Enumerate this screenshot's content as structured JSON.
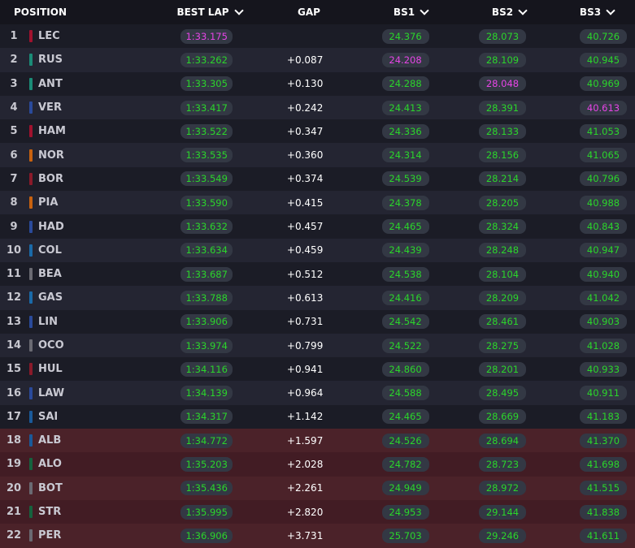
{
  "headers": {
    "position": "POSITION",
    "best_lap": "BEST LAP",
    "gap": "GAP",
    "bs1": "BS1",
    "bs2": "BS2",
    "bs3": "BS3"
  },
  "colors": {
    "personal_best": "#2bd52b",
    "overall_best": "#e645e6",
    "eliminated_row": "#4b2229"
  },
  "rows": [
    {
      "pos": "1",
      "code": "LEC",
      "team_color": "#a0122e",
      "best": "1:33.175",
      "best_purple": true,
      "gap": "",
      "bs1": "24.376",
      "bs1_purple": false,
      "bs2": "28.073",
      "bs2_purple": false,
      "bs3": "40.726",
      "bs3_purple": false,
      "eliminated": false
    },
    {
      "pos": "2",
      "code": "RUS",
      "team_color": "#1b8c77",
      "best": "1:33.262",
      "best_purple": false,
      "gap": "+0.087",
      "bs1": "24.208",
      "bs1_purple": true,
      "bs2": "28.109",
      "bs2_purple": false,
      "bs3": "40.945",
      "bs3_purple": false,
      "eliminated": false
    },
    {
      "pos": "3",
      "code": "ANT",
      "team_color": "#1b8c77",
      "best": "1:33.305",
      "best_purple": false,
      "gap": "+0.130",
      "bs1": "24.288",
      "bs1_purple": false,
      "bs2": "28.048",
      "bs2_purple": true,
      "bs3": "40.969",
      "bs3_purple": false,
      "eliminated": false
    },
    {
      "pos": "4",
      "code": "VER",
      "team_color": "#2a4a9a",
      "best": "1:33.417",
      "best_purple": false,
      "gap": "+0.242",
      "bs1": "24.413",
      "bs1_purple": false,
      "bs2": "28.391",
      "bs2_purple": false,
      "bs3": "40.613",
      "bs3_purple": true,
      "eliminated": false
    },
    {
      "pos": "5",
      "code": "HAM",
      "team_color": "#a0122e",
      "best": "1:33.522",
      "best_purple": false,
      "gap": "+0.347",
      "bs1": "24.336",
      "bs1_purple": false,
      "bs2": "28.133",
      "bs2_purple": false,
      "bs3": "41.053",
      "bs3_purple": false,
      "eliminated": false
    },
    {
      "pos": "6",
      "code": "NOR",
      "team_color": "#c8620f",
      "best": "1:33.535",
      "best_purple": false,
      "gap": "+0.360",
      "bs1": "24.314",
      "bs1_purple": false,
      "bs2": "28.156",
      "bs2_purple": false,
      "bs3": "41.065",
      "bs3_purple": false,
      "eliminated": false
    },
    {
      "pos": "7",
      "code": "BOR",
      "team_color": "#8a1a2a",
      "best": "1:33.549",
      "best_purple": false,
      "gap": "+0.374",
      "bs1": "24.539",
      "bs1_purple": false,
      "bs2": "28.214",
      "bs2_purple": false,
      "bs3": "40.796",
      "bs3_purple": false,
      "eliminated": false
    },
    {
      "pos": "8",
      "code": "PIA",
      "team_color": "#c8620f",
      "best": "1:33.590",
      "best_purple": false,
      "gap": "+0.415",
      "bs1": "24.378",
      "bs1_purple": false,
      "bs2": "28.205",
      "bs2_purple": false,
      "bs3": "40.988",
      "bs3_purple": false,
      "eliminated": false
    },
    {
      "pos": "9",
      "code": "HAD",
      "team_color": "#2a4a9a",
      "best": "1:33.632",
      "best_purple": false,
      "gap": "+0.457",
      "bs1": "24.465",
      "bs1_purple": false,
      "bs2": "28.324",
      "bs2_purple": false,
      "bs3": "40.843",
      "bs3_purple": false,
      "eliminated": false
    },
    {
      "pos": "10",
      "code": "COL",
      "team_color": "#1a6aa8",
      "best": "1:33.634",
      "best_purple": false,
      "gap": "+0.459",
      "bs1": "24.439",
      "bs1_purple": false,
      "bs2": "28.248",
      "bs2_purple": false,
      "bs3": "40.947",
      "bs3_purple": false,
      "eliminated": false
    },
    {
      "pos": "11",
      "code": "BEA",
      "team_color": "#6a6a72",
      "best": "1:33.687",
      "best_purple": false,
      "gap": "+0.512",
      "bs1": "24.538",
      "bs1_purple": false,
      "bs2": "28.104",
      "bs2_purple": false,
      "bs3": "40.940",
      "bs3_purple": false,
      "eliminated": false
    },
    {
      "pos": "12",
      "code": "GAS",
      "team_color": "#1a6aa8",
      "best": "1:33.788",
      "best_purple": false,
      "gap": "+0.613",
      "bs1": "24.416",
      "bs1_purple": false,
      "bs2": "28.209",
      "bs2_purple": false,
      "bs3": "41.042",
      "bs3_purple": false,
      "eliminated": false
    },
    {
      "pos": "13",
      "code": "LIN",
      "team_color": "#2a4a9a",
      "best": "1:33.906",
      "best_purple": false,
      "gap": "+0.731",
      "bs1": "24.542",
      "bs1_purple": false,
      "bs2": "28.461",
      "bs2_purple": false,
      "bs3": "40.903",
      "bs3_purple": false,
      "eliminated": false
    },
    {
      "pos": "14",
      "code": "OCO",
      "team_color": "#6a6a72",
      "best": "1:33.974",
      "best_purple": false,
      "gap": "+0.799",
      "bs1": "24.522",
      "bs1_purple": false,
      "bs2": "28.275",
      "bs2_purple": false,
      "bs3": "41.028",
      "bs3_purple": false,
      "eliminated": false
    },
    {
      "pos": "15",
      "code": "HUL",
      "team_color": "#8a1a2a",
      "best": "1:34.116",
      "best_purple": false,
      "gap": "+0.941",
      "bs1": "24.860",
      "bs1_purple": false,
      "bs2": "28.201",
      "bs2_purple": false,
      "bs3": "40.933",
      "bs3_purple": false,
      "eliminated": false
    },
    {
      "pos": "16",
      "code": "LAW",
      "team_color": "#2a4a9a",
      "best": "1:34.139",
      "best_purple": false,
      "gap": "+0.964",
      "bs1": "24.588",
      "bs1_purple": false,
      "bs2": "28.495",
      "bs2_purple": false,
      "bs3": "40.911",
      "bs3_purple": false,
      "eliminated": false
    },
    {
      "pos": "17",
      "code": "SAI",
      "team_color": "#1a5a9a",
      "best": "1:34.317",
      "best_purple": false,
      "gap": "+1.142",
      "bs1": "24.465",
      "bs1_purple": false,
      "bs2": "28.669",
      "bs2_purple": false,
      "bs3": "41.183",
      "bs3_purple": false,
      "eliminated": false
    },
    {
      "pos": "18",
      "code": "ALB",
      "team_color": "#1a5a9a",
      "best": "1:34.772",
      "best_purple": false,
      "gap": "+1.597",
      "bs1": "24.526",
      "bs1_purple": false,
      "bs2": "28.694",
      "bs2_purple": false,
      "bs3": "41.370",
      "bs3_purple": false,
      "eliminated": true
    },
    {
      "pos": "19",
      "code": "ALO",
      "team_color": "#16623e",
      "best": "1:35.203",
      "best_purple": false,
      "gap": "+2.028",
      "bs1": "24.782",
      "bs1_purple": false,
      "bs2": "28.723",
      "bs2_purple": false,
      "bs3": "41.698",
      "bs3_purple": false,
      "eliminated": true
    },
    {
      "pos": "20",
      "code": "BOT",
      "team_color": "#6a6a72",
      "best": "1:35.436",
      "best_purple": false,
      "gap": "+2.261",
      "bs1": "24.949",
      "bs1_purple": false,
      "bs2": "28.972",
      "bs2_purple": false,
      "bs3": "41.515",
      "bs3_purple": false,
      "eliminated": true
    },
    {
      "pos": "21",
      "code": "STR",
      "team_color": "#16623e",
      "best": "1:35.995",
      "best_purple": false,
      "gap": "+2.820",
      "bs1": "24.953",
      "bs1_purple": false,
      "bs2": "29.144",
      "bs2_purple": false,
      "bs3": "41.838",
      "bs3_purple": false,
      "eliminated": true
    },
    {
      "pos": "22",
      "code": "PER",
      "team_color": "#6a6a72",
      "best": "1:36.906",
      "best_purple": false,
      "gap": "+3.731",
      "bs1": "25.703",
      "bs1_purple": false,
      "bs2": "29.246",
      "bs2_purple": false,
      "bs3": "41.611",
      "bs3_purple": false,
      "eliminated": true
    }
  ]
}
